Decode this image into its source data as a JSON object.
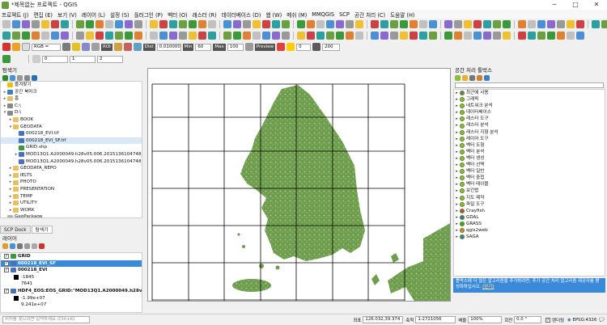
{
  "window": {
    "title": "*제목없는 프로젝트 - QGIS",
    "minimize": "─",
    "maximize": "□",
    "close": "✕"
  },
  "menu": [
    "프로젝트 (J)",
    "편집 (E)",
    "보기 (V)",
    "레이어 (L)",
    "설정 (S)",
    "플러그인 (P)",
    "벡터 (O)",
    "래스터 (R)",
    "데이터베이스 (D)",
    "웹 (W)",
    "메쉬 (M)",
    "MMQGIS",
    "SCP",
    "공간 처리 (C)",
    "도움말 (H)"
  ],
  "toolbar3": {
    "rgb_label": "RGB =",
    "roi_label": "ROI",
    "dist_label": "Dist",
    "dist_value": "0.010000",
    "min_label": "Min",
    "min_value": "60",
    "max_label": "Max",
    "max_value": "100",
    "preview_label": "Preview",
    "preview_value": "0",
    "end_value": "200"
  },
  "toolbar4": {
    "val1": "0",
    "val2": "1",
    "val3": "2"
  },
  "browser": {
    "title": "탐색기",
    "items": [
      {
        "label": "즐겨찾기",
        "indent": 0,
        "arrow": "",
        "icon": "star"
      },
      {
        "label": "공간 북마크",
        "indent": 0,
        "arrow": "▸",
        "icon": "bookmark"
      },
      {
        "label": "홈",
        "indent": 0,
        "arrow": "▸",
        "icon": "folder"
      },
      {
        "label": "C:\\",
        "indent": 0,
        "arrow": "▸",
        "icon": "drive"
      },
      {
        "label": "D:\\",
        "indent": 0,
        "arrow": "▾",
        "icon": "drive"
      },
      {
        "label": "BOOK",
        "indent": 1,
        "arrow": "▸",
        "icon": "folder"
      },
      {
        "label": "GEODATA",
        "indent": 1,
        "arrow": "▾",
        "icon": "folder"
      },
      {
        "label": "000218_EVI.tif",
        "indent": 2,
        "arrow": "",
        "icon": "raster"
      },
      {
        "label": "000218_EVI_SF.tif",
        "indent": 2,
        "arrow": "",
        "icon": "raster",
        "selected": true
      },
      {
        "label": "GRID.shp",
        "indent": 2,
        "arrow": "",
        "icon": "vector"
      },
      {
        "label": "MOD13Q1.A2000049.h28v05.006.2015136104748",
        "indent": 2,
        "arrow": "▸",
        "icon": "raster"
      },
      {
        "label": "MOD13Q1.A2000049.h28v05.006.2015136104748",
        "indent": 2,
        "arrow": "",
        "icon": "raster"
      },
      {
        "label": "GEODATA_REPO",
        "indent": 1,
        "arrow": "▸",
        "icon": "folder"
      },
      {
        "label": "IELTS",
        "indent": 1,
        "arrow": "▸",
        "icon": "folder"
      },
      {
        "label": "PHOTO",
        "indent": 1,
        "arrow": "▸",
        "icon": "folder"
      },
      {
        "label": "PRESENTATION",
        "indent": 1,
        "arrow": "▸",
        "icon": "folder"
      },
      {
        "label": "TEMP",
        "indent": 1,
        "arrow": "▸",
        "icon": "folder"
      },
      {
        "label": "UTILITY",
        "indent": 1,
        "arrow": "▸",
        "icon": "folder"
      },
      {
        "label": "WORK",
        "indent": 1,
        "arrow": "▸",
        "icon": "folder"
      },
      {
        "label": "GeoPackage",
        "indent": 0,
        "arrow": "",
        "icon": "gpkg"
      }
    ]
  },
  "dock_tabs": [
    "SCP Dock",
    "탐색기"
  ],
  "layers": {
    "title": "레이어",
    "rows": [
      {
        "type": "layer",
        "label": "GRID",
        "checked": true,
        "icon": "vector"
      },
      {
        "type": "layer",
        "label": "000218_EVI_SF",
        "checked": true,
        "icon": "raster",
        "selected": true
      },
      {
        "type": "layer",
        "label": "000218_EVI",
        "checked": true,
        "icon": "raster"
      },
      {
        "type": "legend",
        "label": "-1845"
      },
      {
        "type": "legend-text",
        "label": "7641"
      },
      {
        "type": "layer",
        "label": "HDF4_EOS:EOS_GRID:\"MOD13Q1.A2000049.h28v05",
        "checked": true,
        "icon": "raster"
      },
      {
        "type": "legend",
        "label": "-1.99e+07"
      },
      {
        "type": "legend-text",
        "label": "9.241e+07"
      }
    ]
  },
  "toolbox": {
    "title": "공간 처리 툴박스",
    "items": [
      {
        "label": "최근에 사용",
        "icon": "clock"
      },
      {
        "label": "그래픽",
        "icon": "q"
      },
      {
        "label": "네트워크 분석",
        "icon": "q"
      },
      {
        "label": "데이터베이스",
        "icon": "q"
      },
      {
        "label": "래스터 도구",
        "icon": "q"
      },
      {
        "label": "래스터 분석",
        "icon": "q"
      },
      {
        "label": "래스터 지형 분석",
        "icon": "q"
      },
      {
        "label": "레이어 도구",
        "icon": "q"
      },
      {
        "label": "벡터 도형",
        "icon": "q"
      },
      {
        "label": "벡터 분석",
        "icon": "q"
      },
      {
        "label": "벡터 생성",
        "icon": "q"
      },
      {
        "label": "벡터 선택",
        "icon": "q"
      },
      {
        "label": "벡터 일반",
        "icon": "q"
      },
      {
        "label": "벡터 중첩",
        "icon": "q"
      },
      {
        "label": "벡터 테이블",
        "icon": "q"
      },
      {
        "label": "보간법",
        "icon": "q"
      },
      {
        "label": "지도 제작",
        "icon": "q"
      },
      {
        "label": "파일 도구",
        "icon": "q"
      },
      {
        "label": "Crayfish",
        "icon": "crayfish"
      },
      {
        "label": "GDAL",
        "icon": "gdal"
      },
      {
        "label": "GRASS",
        "icon": "grass"
      },
      {
        "label": "qgis2web",
        "icon": "web"
      },
      {
        "label": "SAGA",
        "icon": "saga"
      }
    ]
  },
  "banner": {
    "text": "툴박스에 더 많은 알고리즘을 추가하려면, 추가 공간 처리 알고리즘 제공자를 활성화하십시오.",
    "close_link": "[닫기]"
  },
  "statusbar": {
    "search_placeholder": "위치를 찾으려면 입력하세요 (Ctrl+K)",
    "coord_label": "좌표",
    "coord_value": "126.032,39.374",
    "scale_label": "축척",
    "scale_value": "1:2721056",
    "magnifier_label": "배율",
    "magnifier_value": "100%",
    "rotation_label": "회전",
    "rotation_value": "0.0 °",
    "render_label": "렌더링",
    "crs": "EPSG:4326"
  },
  "colors": {
    "land_green": "#6f9e4e",
    "land_light": "#a9c98e",
    "selection_blue": "#3b8ad9"
  }
}
